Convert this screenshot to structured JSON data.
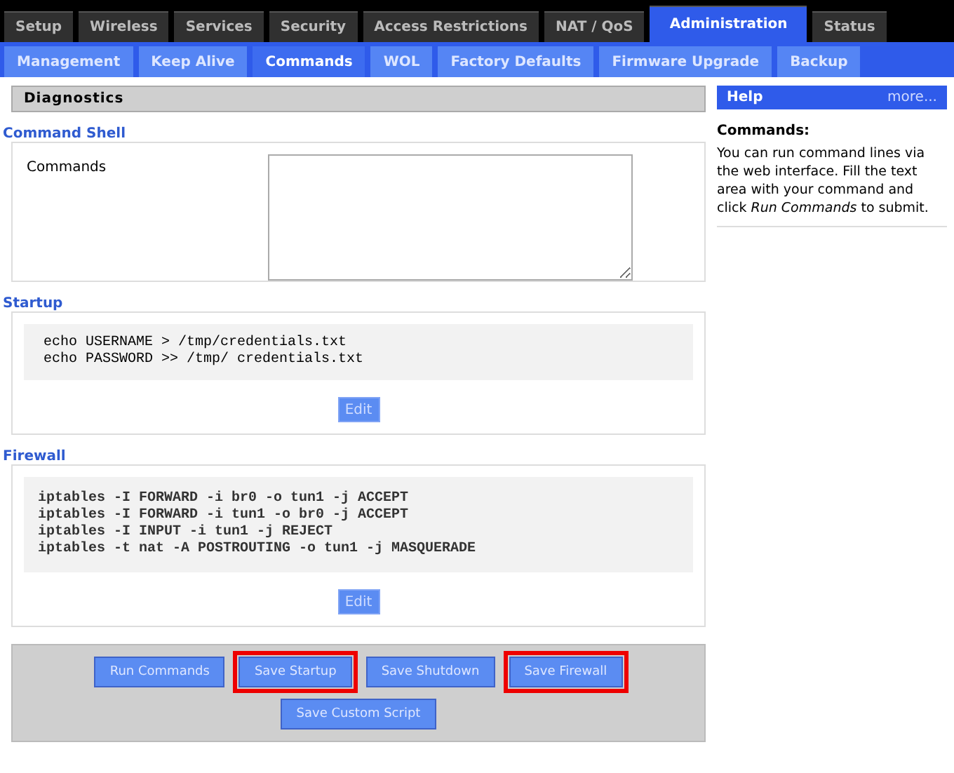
{
  "main_tabs": [
    {
      "label": "Setup",
      "selected": false
    },
    {
      "label": "Wireless",
      "selected": false
    },
    {
      "label": "Services",
      "selected": false
    },
    {
      "label": "Security",
      "selected": false
    },
    {
      "label": "Access Restrictions",
      "selected": false
    },
    {
      "label": "NAT / QoS",
      "selected": false
    },
    {
      "label": "Administration",
      "selected": true
    },
    {
      "label": "Status",
      "selected": false
    }
  ],
  "sub_tabs": [
    {
      "label": "Management",
      "selected": false
    },
    {
      "label": "Keep Alive",
      "selected": false
    },
    {
      "label": "Commands",
      "selected": true
    },
    {
      "label": "WOL",
      "selected": false
    },
    {
      "label": "Factory Defaults",
      "selected": false
    },
    {
      "label": "Firmware Upgrade",
      "selected": false
    },
    {
      "label": "Backup",
      "selected": false
    }
  ],
  "section_title": "Diagnostics",
  "command_shell": {
    "legend": "Command Shell",
    "label": "Commands"
  },
  "startup": {
    "legend": "Startup",
    "lines": [
      "echo USERNAME > /tmp/credentials.txt",
      "echo PASSWORD >> /tmp/ credentials.txt"
    ],
    "button": "Edit"
  },
  "firewall": {
    "legend": "Firewall",
    "lines": [
      "iptables -I FORWARD -i br0 -o tun1 -j ACCEPT",
      "iptables -I FORWARD -i tun1 -o br0 -j ACCEPT",
      "iptables -I INPUT -i tun1 -j REJECT",
      "iptables -t nat -A POSTROUTING -o tun1 -j MASQUERADE"
    ],
    "button": "Edit"
  },
  "action_buttons": [
    {
      "label": "Run Commands",
      "highlighted": false
    },
    {
      "label": "Save Startup",
      "highlighted": true
    },
    {
      "label": "Save Shutdown",
      "highlighted": false
    },
    {
      "label": "Save Firewall",
      "highlighted": true
    },
    {
      "label": "Save Custom Script",
      "highlighted": false
    }
  ],
  "help": {
    "title": "Help",
    "more": "more...",
    "heading": "Commands:",
    "text": "You can run command lines via the web interface. Fill the text area with your command and click *Run Commands* to submit."
  }
}
